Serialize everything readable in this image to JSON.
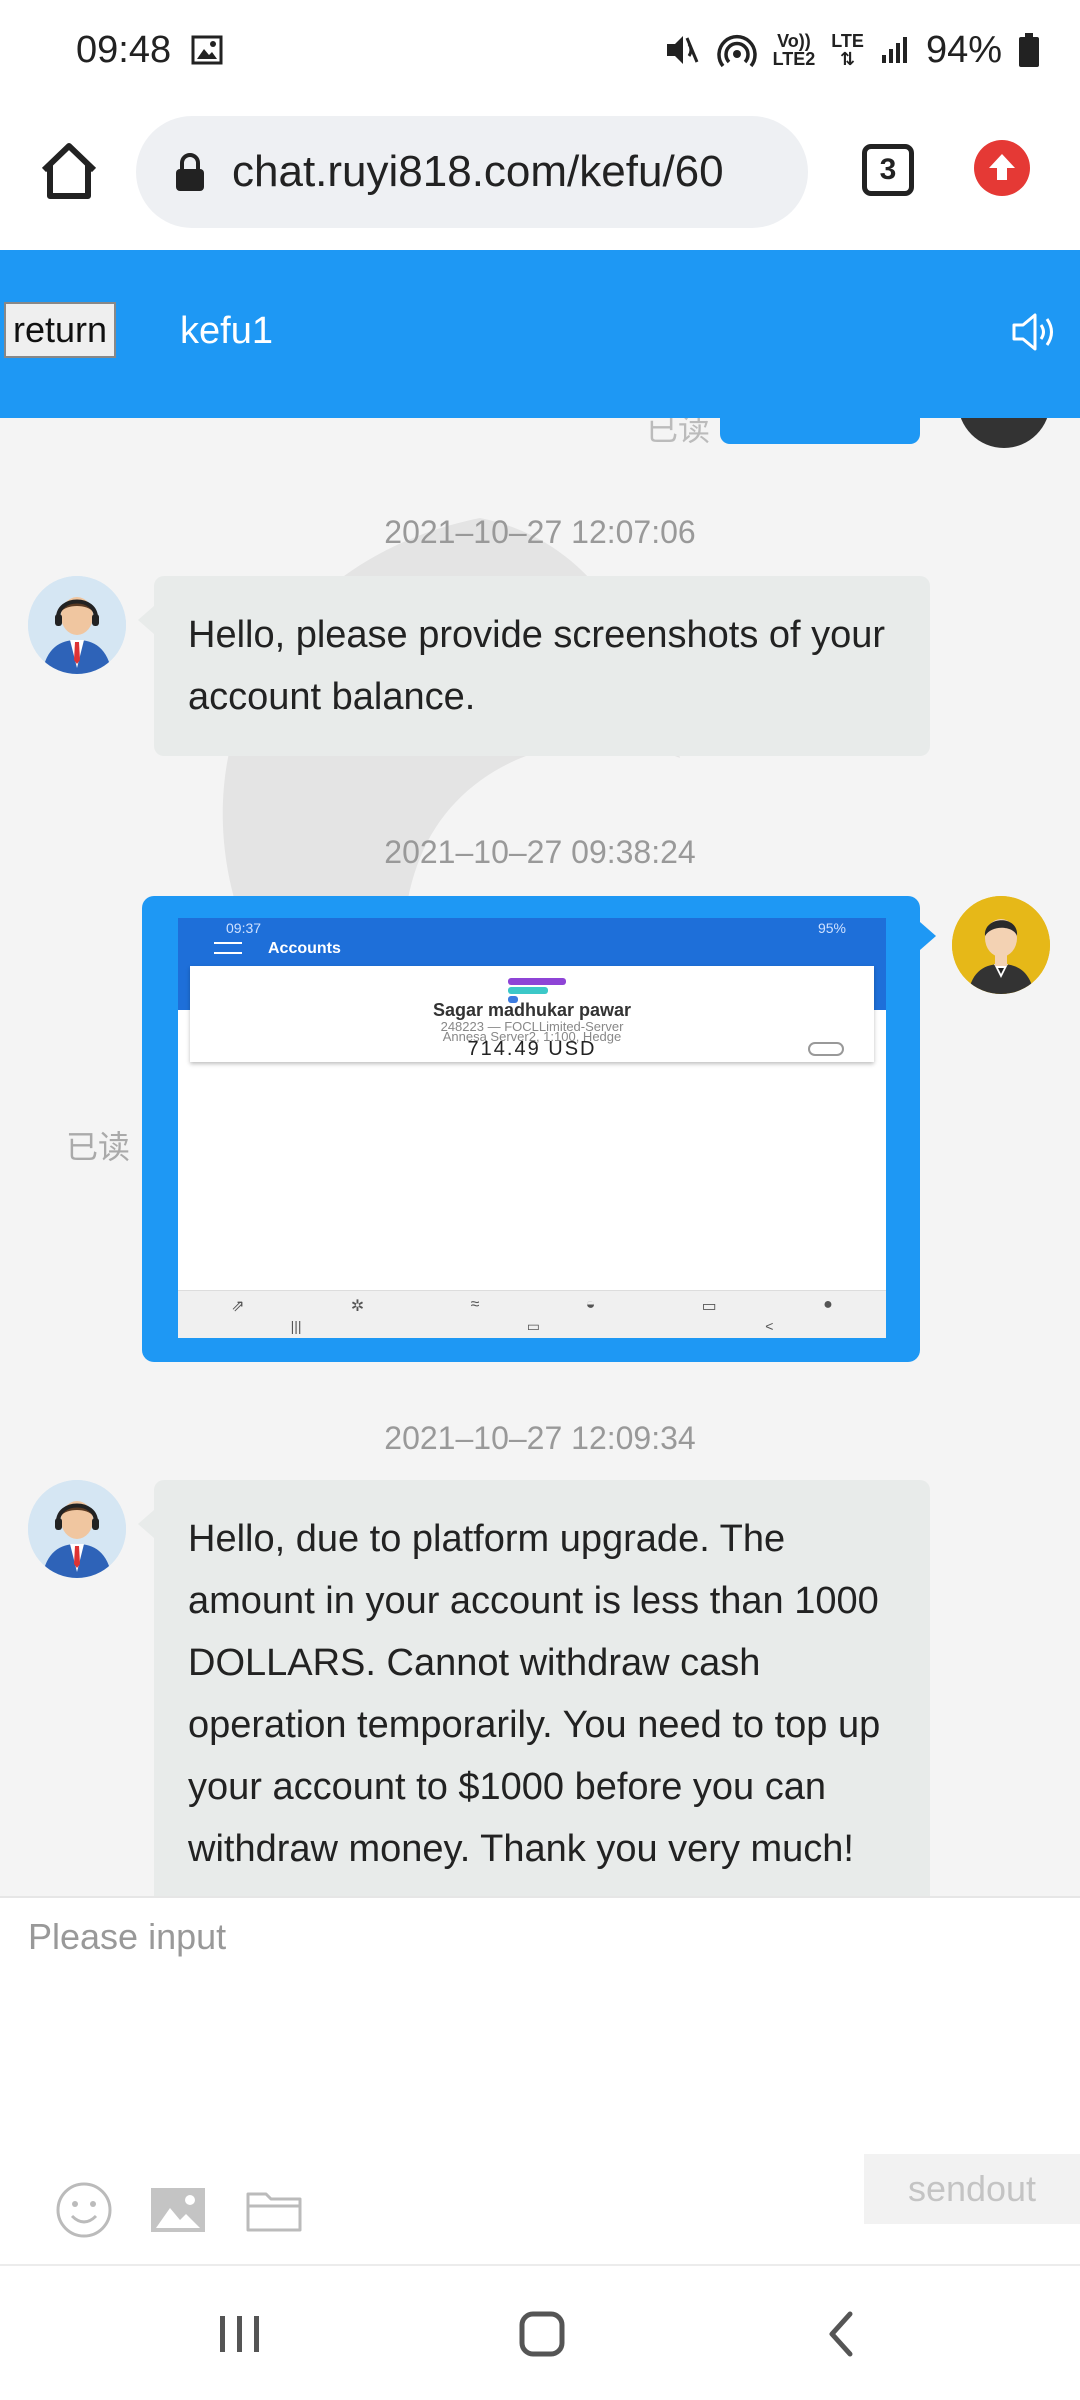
{
  "status_bar": {
    "time": "09:48",
    "volte": "Vo))",
    "lte2": "LTE2",
    "lte": "LTE",
    "battery": "94%"
  },
  "browser": {
    "url": "chat.ruyi818.com/kefu/60",
    "tab_count": "3"
  },
  "header": {
    "return_label": "return",
    "agent_name": "kefu1"
  },
  "chat": {
    "partial_read_label": "已读",
    "messages": [
      {
        "timestamp": "2021–10–27 12:07:06",
        "sender": "agent",
        "text": "Hello, please provide screenshots of your account balance."
      },
      {
        "timestamp": "2021–10–27 09:38:24",
        "sender": "user",
        "type": "image",
        "read_label": "已读",
        "image": {
          "status_time": "09:37",
          "status_right": "95%",
          "title": "Accounts",
          "name": "Sagar madhukar pawar",
          "line1": "248223 — FOCLLimited-Server",
          "line2": "Annesa Server2, 1:100, Hedge",
          "balance": "714.49 USD"
        }
      },
      {
        "timestamp": "2021–10–27 12:09:34",
        "sender": "agent",
        "text": "Hello, due to platform upgrade. The amount in your account is less than 1000 DOLLARS. Cannot withdraw cash operation temporarily. You need to top up your account to $1000 before you can withdraw money. Thank you very much!"
      }
    ]
  },
  "composer": {
    "placeholder": "Please input",
    "send_label": "sendout"
  },
  "colors": {
    "accent": "#1e98f4",
    "incoming_bubble": "#e8ebea",
    "user_avatar": "#e6b818",
    "upload_red": "#e53935"
  }
}
